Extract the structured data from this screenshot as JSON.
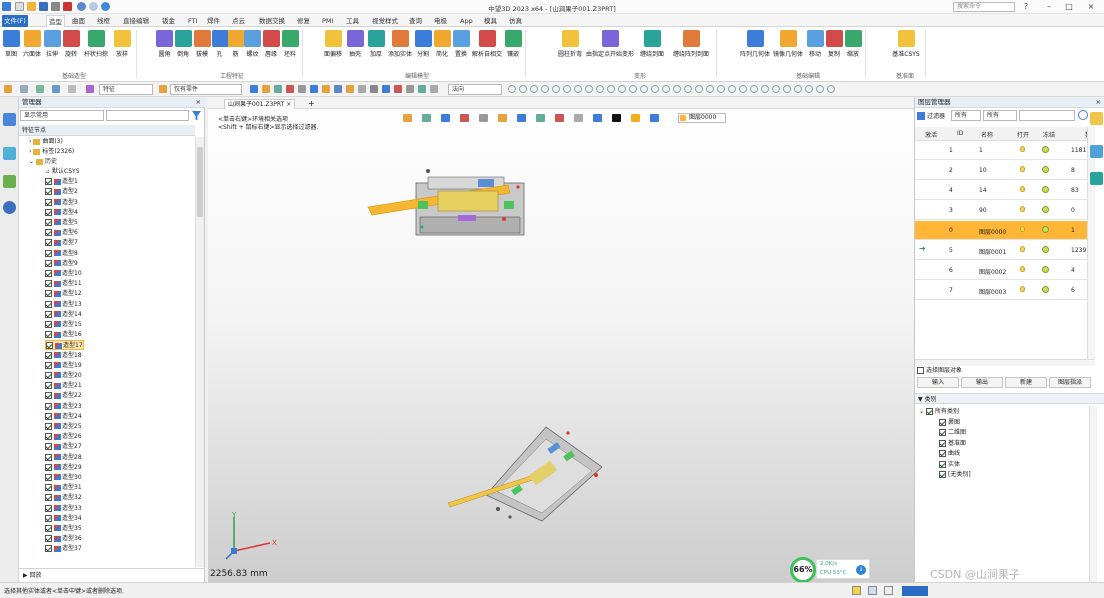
{
  "window": {
    "title": "中望3D 2023 x64 - [山涧果子001.Z3PRT]",
    "command_search_placeholder": "搜索命令"
  },
  "tabs": [
    "文件(F)",
    "造型",
    "曲面",
    "线框",
    "直接编辑",
    "钣金",
    "FTI",
    "焊件",
    "点云",
    "数据交换",
    "修复",
    "PMI",
    "工具",
    "视觉样式",
    "查询",
    "电极",
    "App",
    "模具",
    "仿真"
  ],
  "ribbon": {
    "groups": [
      {
        "label": "基础造型",
        "buttons": [
          "草图",
          "六面体",
          "拉伸",
          "旋转",
          "杆状扫掠",
          "放样"
        ]
      },
      {
        "label": "工程特征",
        "buttons": [
          "圆角",
          "倒角",
          "拔模",
          "孔",
          "筋",
          "螺纹",
          "唇缘",
          "坯料"
        ]
      },
      {
        "label": "编辑模型",
        "buttons": [
          "面偏移",
          "抽壳",
          "加厚",
          "添加实体",
          "分割",
          "简化",
          "置换",
          "解析自相交",
          "镶嵌"
        ]
      },
      {
        "label": "变形",
        "buttons": [
          "圆柱折弯",
          "由指定点开始变形",
          "缠绕到面",
          "缠绕阵列到面"
        ]
      },
      {
        "label": "基础编辑",
        "buttons": [
          "阵列几何体",
          "镜像几何体",
          "移动",
          "复制",
          "缩放"
        ]
      },
      {
        "label": "基准面",
        "buttons": [
          "基准CSYS"
        ]
      }
    ]
  },
  "toolbar2": {
    "filter_value": "特征",
    "part_filter": "仅有零件",
    "normal_value": "法向"
  },
  "manager": {
    "title": "管理器",
    "display": "显示常用",
    "section": "特征节点",
    "top_nodes": [
      "曲面(3)",
      "标签(2326)",
      "历史"
    ],
    "default_csys": "默认CSYS",
    "features": [
      "造型1",
      "造型2",
      "造型3",
      "造型4",
      "造型5",
      "造型6",
      "造型7",
      "造型8",
      "造型9",
      "造型10",
      "造型11",
      "造型12",
      "造型13",
      "造型14",
      "造型15",
      "造型16",
      "造型17",
      "造型18",
      "造型19",
      "造型20",
      "造型21",
      "造型22",
      "造型23",
      "造型24",
      "造型25",
      "造型26",
      "造型27",
      "造型28",
      "造型29",
      "造型30",
      "造型31",
      "造型32",
      "造型33",
      "造型34",
      "造型35",
      "造型36",
      "造型37"
    ],
    "selected_feature": "造型17",
    "rollback": "回放"
  },
  "viewport": {
    "tab": "山涧果子001.Z3PRT",
    "hint1": "<单击右键>环境相关选项",
    "hint2": "<Shift + 鼠标右键>显示选择过滤器.",
    "layer_combo": "图层0000",
    "scale": "2256.83 mm",
    "perf_percent": "66%",
    "perf_up": "2.0K/s",
    "perf_cpu": "CPU 53°C"
  },
  "layer_panel": {
    "title": "图层管理器",
    "filter_label": "过滤器",
    "filter_1": "所有",
    "filter_2": "所有",
    "headers": [
      "激活",
      "ID",
      "名称",
      "打开",
      "冻结",
      "数"
    ],
    "rows": [
      {
        "id": "1",
        "name": "1",
        "count": "1181",
        "active": false,
        "highlight": false
      },
      {
        "id": "2",
        "name": "10",
        "count": "8",
        "active": false,
        "highlight": false
      },
      {
        "id": "4",
        "name": "14",
        "count": "83",
        "active": false,
        "highlight": false
      },
      {
        "id": "3",
        "name": "90",
        "count": "0",
        "active": false,
        "highlight": false
      },
      {
        "id": "0",
        "name": "图层0000",
        "count": "1",
        "active": false,
        "highlight": true
      },
      {
        "id": "5",
        "name": "图层0001",
        "count": "1239",
        "active": true,
        "highlight": false
      },
      {
        "id": "6",
        "name": "图层0002",
        "count": "4",
        "active": false,
        "highlight": false
      },
      {
        "id": "7",
        "name": "图层0003",
        "count": "6",
        "active": false,
        "highlight": false
      }
    ],
    "select_objects": "选择图层对象",
    "buttons": [
      "输入",
      "输出",
      "新建",
      "图层指派"
    ],
    "category_title": "类别",
    "categories": [
      "所有类别",
      "裹图",
      "二维图",
      "基准面",
      "曲线",
      "实体",
      "[无类别]"
    ]
  },
  "status": {
    "message": "选择其他实体或者<单击中键>或者删除选项."
  },
  "watermark": "CSDN @山涧果子",
  "colors": {
    "accent": "#2b6cc4",
    "highlight": "#ffb636",
    "selection": "#fde8b4"
  }
}
